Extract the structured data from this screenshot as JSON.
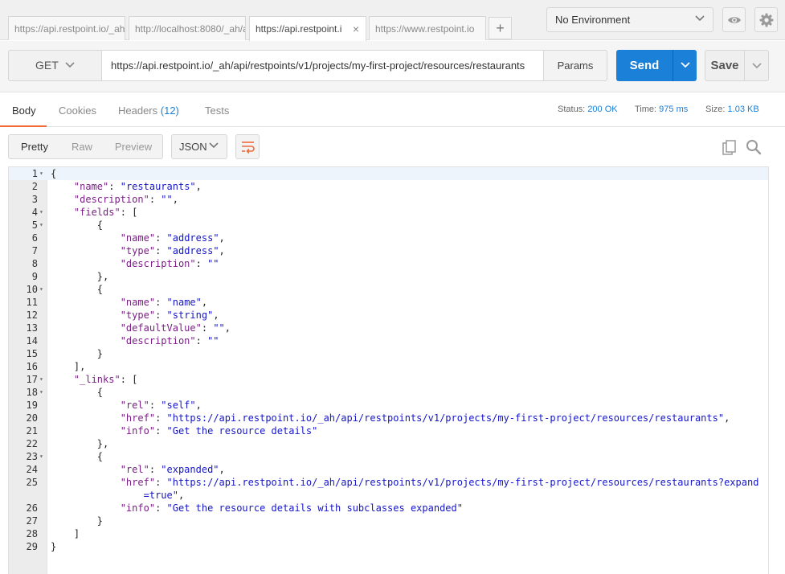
{
  "tabs": [
    {
      "label": "https://api.restpoint.io/_ah",
      "active": false
    },
    {
      "label": "http://localhost:8080/_ah/a",
      "active": false
    },
    {
      "label": "https://api.restpoint.i",
      "active": true,
      "close": "×"
    },
    {
      "label": "https://www.restpoint.io",
      "active": false
    }
  ],
  "tab_add": "+",
  "environment": {
    "label": "No Environment"
  },
  "request": {
    "method": "GET",
    "url": "https://api.restpoint.io/_ah/api/restpoints/v1/projects/my-first-project/resources/restaurants",
    "params_label": "Params",
    "send_label": "Send",
    "save_label": "Save"
  },
  "response_tabs": {
    "body": "Body",
    "cookies": "Cookies",
    "headers": "Headers",
    "headers_count": "(12)",
    "tests": "Tests"
  },
  "status": {
    "status_label": "Status:",
    "status_value": "200 OK",
    "time_label": "Time:",
    "time_value": "975 ms",
    "size_label": "Size:",
    "size_value": "1.03 KB"
  },
  "view": {
    "pretty": "Pretty",
    "raw": "Raw",
    "preview": "Preview",
    "format": "JSON"
  },
  "icons": [
    "eye-icon",
    "gear-icon",
    "chevron-down-icon",
    "wrap-icon",
    "copy-icon",
    "search-icon"
  ],
  "colors": {
    "send": "#1a80d8",
    "active_tab_underline": "#f26b3a",
    "json_key": "#7a1f85",
    "json_string": "#1515c8"
  },
  "code_lines": [
    {
      "n": "1",
      "fold": "▾",
      "html": "<span class='p'>{</span>"
    },
    {
      "n": "2",
      "fold": "",
      "html": "    <span class='k'>\"name\"</span><span class='p'>: </span><span class='s'>\"restaurants\"</span><span class='p'>,</span>"
    },
    {
      "n": "3",
      "fold": "",
      "html": "    <span class='k'>\"description\"</span><span class='p'>: </span><span class='s'>\"\"</span><span class='p'>,</span>"
    },
    {
      "n": "4",
      "fold": "▾",
      "html": "    <span class='k'>\"fields\"</span><span class='p'>: [</span>"
    },
    {
      "n": "5",
      "fold": "▾",
      "html": "        <span class='p'>{</span>"
    },
    {
      "n": "6",
      "fold": "",
      "html": "            <span class='k'>\"name\"</span><span class='p'>: </span><span class='s'>\"address\"</span><span class='p'>,</span>"
    },
    {
      "n": "7",
      "fold": "",
      "html": "            <span class='k'>\"type\"</span><span class='p'>: </span><span class='s'>\"address\"</span><span class='p'>,</span>"
    },
    {
      "n": "8",
      "fold": "",
      "html": "            <span class='k'>\"description\"</span><span class='p'>: </span><span class='s'>\"\"</span>"
    },
    {
      "n": "9",
      "fold": "",
      "html": "        <span class='p'>},</span>"
    },
    {
      "n": "10",
      "fold": "▾",
      "html": "        <span class='p'>{</span>"
    },
    {
      "n": "11",
      "fold": "",
      "html": "            <span class='k'>\"name\"</span><span class='p'>: </span><span class='s'>\"name\"</span><span class='p'>,</span>"
    },
    {
      "n": "12",
      "fold": "",
      "html": "            <span class='k'>\"type\"</span><span class='p'>: </span><span class='s'>\"string\"</span><span class='p'>,</span>"
    },
    {
      "n": "13",
      "fold": "",
      "html": "            <span class='k'>\"defaultValue\"</span><span class='p'>: </span><span class='s'>\"\"</span><span class='p'>,</span>"
    },
    {
      "n": "14",
      "fold": "",
      "html": "            <span class='k'>\"description\"</span><span class='p'>: </span><span class='s'>\"\"</span>"
    },
    {
      "n": "15",
      "fold": "",
      "html": "        <span class='p'>}</span>"
    },
    {
      "n": "16",
      "fold": "",
      "html": "    <span class='p'>],</span>"
    },
    {
      "n": "17",
      "fold": "▾",
      "html": "    <span class='k'>\"_links\"</span><span class='p'>: [</span>"
    },
    {
      "n": "18",
      "fold": "▾",
      "html": "        <span class='p'>{</span>"
    },
    {
      "n": "19",
      "fold": "",
      "html": "            <span class='k'>\"rel\"</span><span class='p'>: </span><span class='s'>\"self\"</span><span class='p'>,</span>"
    },
    {
      "n": "20",
      "fold": "",
      "html": "            <span class='k'>\"href\"</span><span class='p'>: </span><span class='s'>\"https://api.restpoint.io/_ah/api/restpoints/v1/projects/my-first-project/resources/restaurants\"</span><span class='p'>,</span>"
    },
    {
      "n": "21",
      "fold": "",
      "html": "            <span class='k'>\"info\"</span><span class='p'>: </span><span class='s'>\"Get the resource details\"</span>"
    },
    {
      "n": "22",
      "fold": "",
      "html": "        <span class='p'>},</span>"
    },
    {
      "n": "23",
      "fold": "▾",
      "html": "        <span class='p'>{</span>"
    },
    {
      "n": "24",
      "fold": "",
      "html": "            <span class='k'>\"rel\"</span><span class='p'>: </span><span class='s'>\"expanded\"</span><span class='p'>,</span>"
    },
    {
      "n": "25",
      "fold": "",
      "html": "            <span class='k'>\"href\"</span><span class='p'>: </span><span class='s'>\"https://api.restpoint.io/_ah/api/restpoints/v1/projects/my-first-project/resources/restaurants?expand</span>"
    },
    {
      "n": "",
      "fold": "",
      "html": "                <span class='s'>=true\"</span><span class='p'>,</span>"
    },
    {
      "n": "26",
      "fold": "",
      "html": "            <span class='k'>\"info\"</span><span class='p'>: </span><span class='s'>\"Get the resource details with subclasses expanded\"</span>"
    },
    {
      "n": "27",
      "fold": "",
      "html": "        <span class='p'>}</span>"
    },
    {
      "n": "28",
      "fold": "",
      "html": "    <span class='p'>]</span>"
    },
    {
      "n": "29",
      "fold": "",
      "html": "<span class='p'>}</span>"
    }
  ]
}
